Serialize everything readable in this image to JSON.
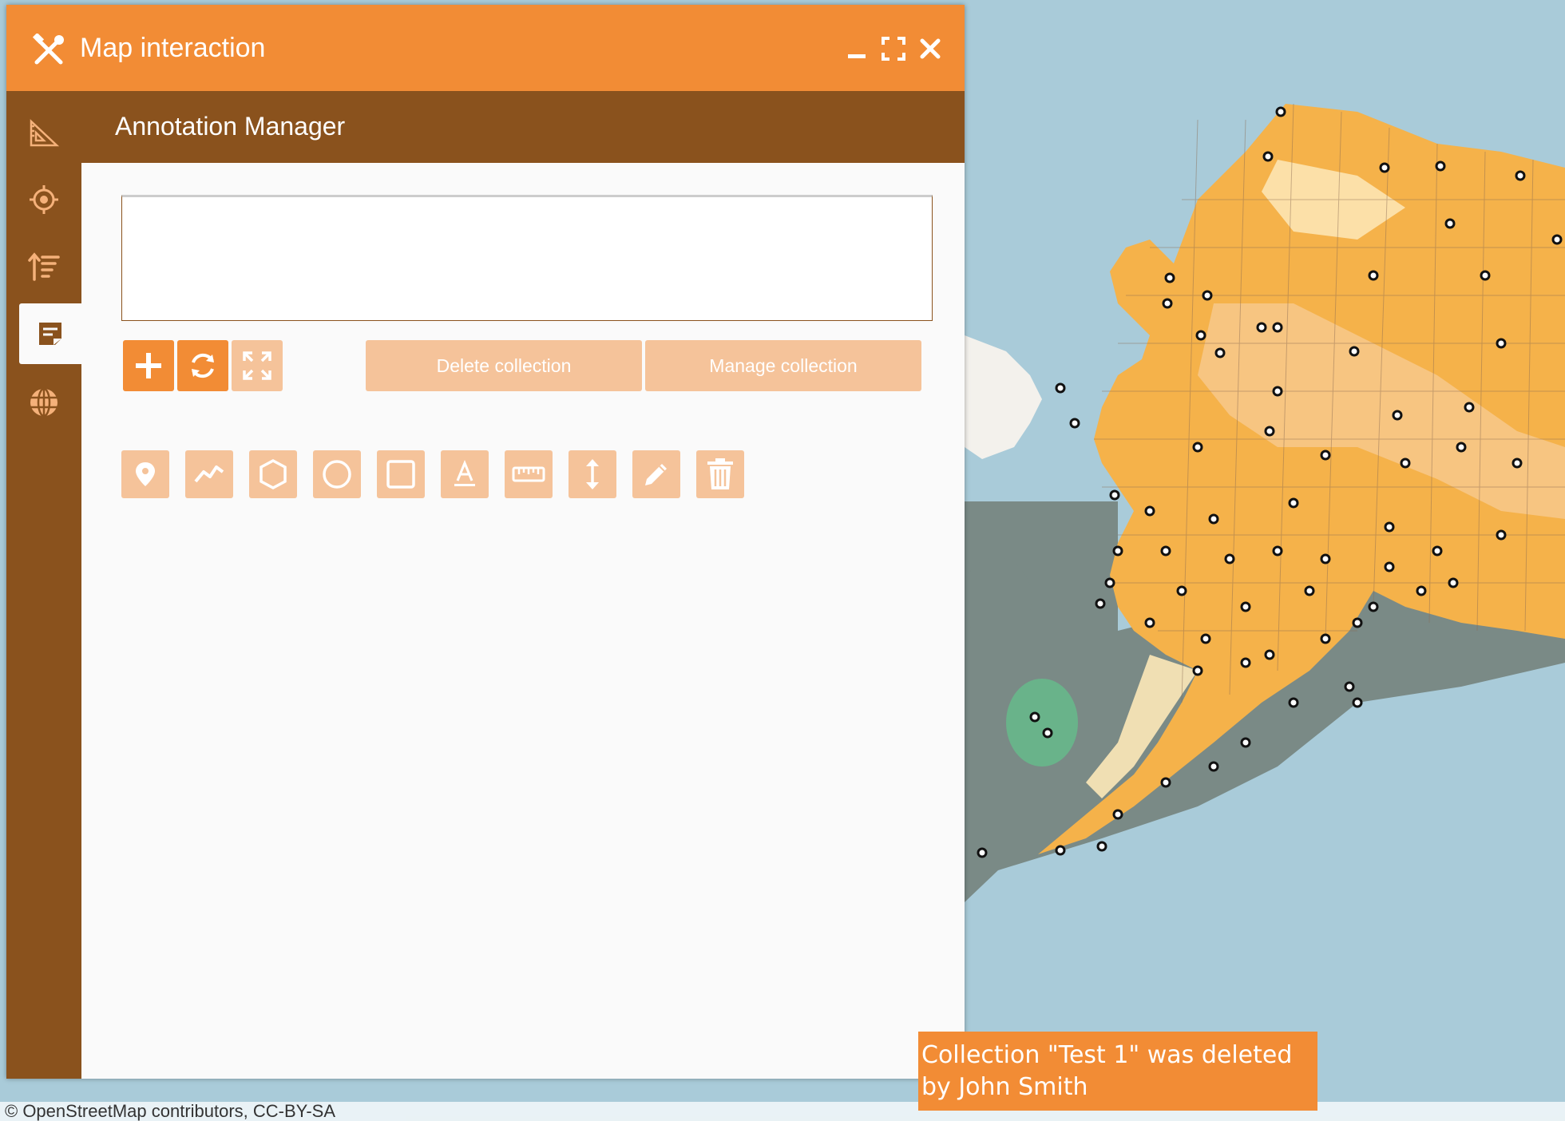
{
  "window": {
    "title": "Map interaction",
    "title_icon": "tools-icon",
    "controls": [
      "minimize-icon",
      "maximize-icon",
      "close-icon"
    ]
  },
  "sidebar": {
    "items": [
      {
        "icon": "ruler-triangle-icon",
        "active": false
      },
      {
        "icon": "crosshair-icon",
        "active": false
      },
      {
        "icon": "sort-list-icon",
        "active": false
      },
      {
        "icon": "note-icon",
        "active": true
      },
      {
        "icon": "globe-icon",
        "active": false
      }
    ]
  },
  "panel": {
    "header": "Annotation Manager",
    "collection_list": [],
    "actions": {
      "add_icon": "plus-icon",
      "refresh_icon": "refresh-icon",
      "fit_icon": "expand-icon",
      "delete_label": "Delete collection",
      "manage_label": "Manage collection"
    },
    "draw_tools": [
      "marker-icon",
      "polyline-icon",
      "polygon-icon",
      "circle-icon",
      "rectangle-icon",
      "text-icon",
      "ruler-icon",
      "height-icon",
      "edit-icon",
      "trash-icon"
    ]
  },
  "toast": {
    "message": "Collection \"Test 1\" was deleted by John Smith"
  },
  "map": {
    "attribution": "© OpenStreetMap contributors, CC-BY-SA"
  },
  "colors": {
    "accent": "#f28c35",
    "accent_disabled": "#f5c39a",
    "brown": "#8a521d",
    "water": "#a9cbd9"
  }
}
